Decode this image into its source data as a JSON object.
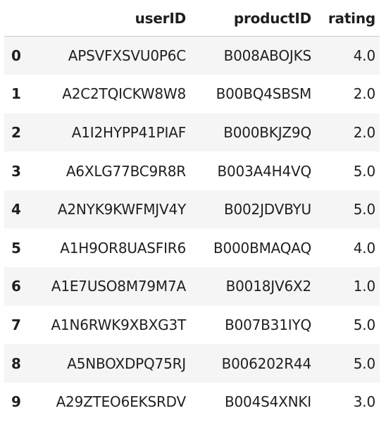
{
  "table": {
    "columns": [
      "userID",
      "productID",
      "rating"
    ],
    "rows": [
      {
        "index": "0",
        "userID": "APSVFXSVU0P6C",
        "productID": "B008ABOJKS",
        "rating": "4.0"
      },
      {
        "index": "1",
        "userID": "A2C2TQICKW8W8",
        "productID": "B00BQ4SBSM",
        "rating": "2.0"
      },
      {
        "index": "2",
        "userID": "A1I2HYPP41PIAF",
        "productID": "B000BKJZ9Q",
        "rating": "2.0"
      },
      {
        "index": "3",
        "userID": "A6XLG77BC9R8R",
        "productID": "B003A4H4VQ",
        "rating": "5.0"
      },
      {
        "index": "4",
        "userID": "A2NYK9KWFMJV4Y",
        "productID": "B002JDVBYU",
        "rating": "5.0"
      },
      {
        "index": "5",
        "userID": "A1H9OR8UASFIR6",
        "productID": "B000BMAQAQ",
        "rating": "4.0"
      },
      {
        "index": "6",
        "userID": "A1E7USO8M79M7A",
        "productID": "B0018JV6X2",
        "rating": "1.0"
      },
      {
        "index": "7",
        "userID": "A1N6RWK9XBXG3T",
        "productID": "B007B31IYQ",
        "rating": "5.0"
      },
      {
        "index": "8",
        "userID": "A5NBOXDPQ75RJ",
        "productID": "B006202R44",
        "rating": "5.0"
      },
      {
        "index": "9",
        "userID": "A29ZTEO6EKSRDV",
        "productID": "B004S4XNKI",
        "rating": "3.0"
      }
    ]
  }
}
